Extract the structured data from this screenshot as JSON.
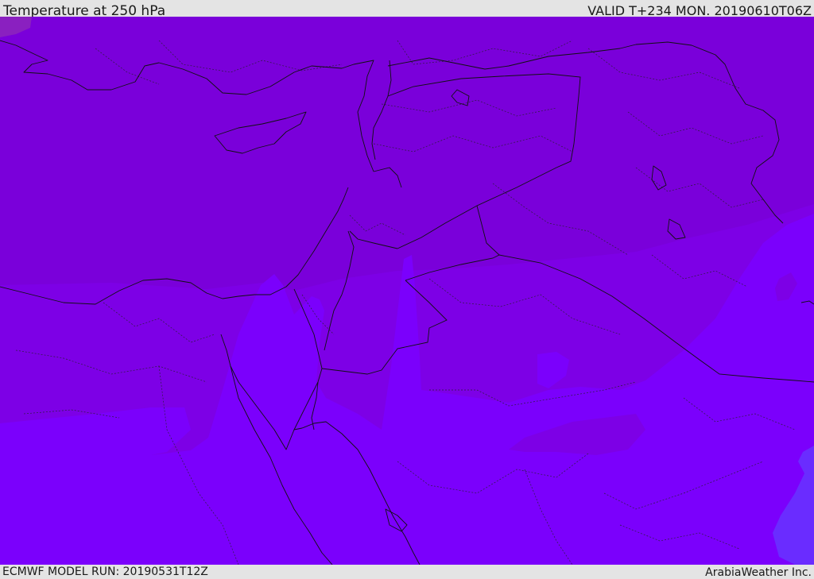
{
  "header": {
    "title": "Temperature at 250 hPa",
    "valid": "VALID T+234 MON. 20190610T06Z"
  },
  "footer": {
    "model_run": "ECMWF MODEL RUN: 20190531T12Z",
    "provider": "ArabiaWeather Inc."
  },
  "colors": {
    "band_cold": "#7a00da",
    "band_mid": "#7d00e6",
    "band_warm": "#7b00fc",
    "band_warmest": "#6a2cff",
    "band_spot": "#8a20c0",
    "frame_bg": "#e4e4e4",
    "line": "#111111"
  }
}
